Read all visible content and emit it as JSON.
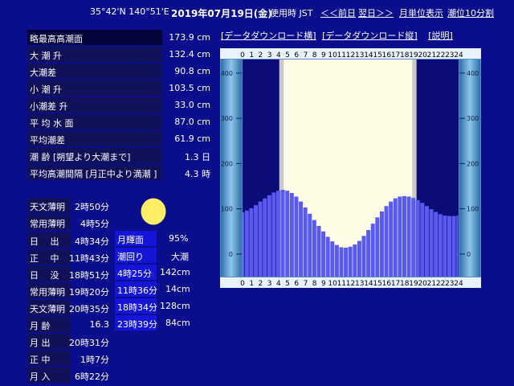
{
  "header": {
    "coords": "35°42'N 140°51'E",
    "date": "2019年07月19日(金)",
    "timezone": "使用時 JST",
    "prev_day": "＜＜前日",
    "next_day": "翌日＞＞",
    "monthly": "月単位表示",
    "interval": "潮位10分割"
  },
  "info": [
    {
      "label": "略最高高潮面",
      "value": "173.9 cm"
    },
    {
      "label": "大 潮 升",
      "value": "132.4 cm"
    },
    {
      "label": "大潮差",
      "value": "90.8 cm"
    },
    {
      "label": "小 潮 升",
      "value": "103.5 cm"
    },
    {
      "label": "小潮差 升",
      "value": "33.0 cm"
    },
    {
      "label": "平 均 水 面",
      "value": "87.0 cm"
    },
    {
      "label": "平均潮差",
      "value": "61.9 cm"
    },
    {
      "label": "潮 齢 [朔望より大潮まで]",
      "value": "1.3 日"
    },
    {
      "label": "平均高潮間隔 [月正中より満潮 ]",
      "value": "4.3 時"
    }
  ],
  "sun_table": [
    {
      "label": "天文薄明",
      "value": "2時50分"
    },
    {
      "label": "常用薄明",
      "value": "4時5分"
    },
    {
      "label": "日　 出",
      "value": "4時34分"
    },
    {
      "label": "正　 中",
      "value": "11時43分"
    },
    {
      "label": "日　 没",
      "value": "18時51分"
    },
    {
      "label": "常用薄明",
      "value": "19時20分"
    },
    {
      "label": "天文薄明",
      "value": "20時35分"
    },
    {
      "label": "月 齢",
      "value": "16.3"
    },
    {
      "label": "月 出",
      "value": "20時31分"
    },
    {
      "label": "正 中",
      "value": "1時7分"
    },
    {
      "label": "月 入",
      "value": "6時22分"
    }
  ],
  "moon": {
    "illum_label": "月輝面",
    "illum_value": "95%",
    "tide_label": "潮回り",
    "tide_value": "大潮"
  },
  "tides": [
    {
      "time": "4時25分",
      "level": "142cm"
    },
    {
      "time": "11時36分",
      "level": "14cm"
    },
    {
      "time": "18時34分",
      "level": "128cm"
    },
    {
      "time": "23時39分",
      "level": "84cm"
    }
  ],
  "chart_links": [
    "[データダウンロード横]",
    "[データダウンロード縦]",
    "[説明]"
  ],
  "chart_data": {
    "type": "bar",
    "xlabel": "",
    "ylabel": "",
    "hours": [
      "0",
      "1",
      "2",
      "3",
      "4",
      "5",
      "6",
      "7",
      "8",
      "9",
      "10",
      "11",
      "12",
      "13",
      "14",
      "15",
      "16",
      "17",
      "18",
      "19",
      "20",
      "21",
      "22",
      "23",
      "24"
    ],
    "y_ticks": [
      "400",
      "300",
      "200",
      "100",
      "0"
    ],
    "ylim": [
      -50,
      430
    ],
    "daylight_hours": [
      4.57,
      18.85
    ],
    "twilight_hours": [
      4.08,
      19.33
    ],
    "x": [
      0,
      0.5,
      1,
      1.5,
      2,
      2.5,
      3,
      3.5,
      4,
      4.5,
      5,
      5.5,
      6,
      6.5,
      7,
      7.5,
      8,
      8.5,
      9,
      9.5,
      10,
      10.5,
      11,
      11.5,
      12,
      12.5,
      13,
      13.5,
      14,
      14.5,
      15,
      15.5,
      16,
      16.5,
      17,
      17.5,
      18,
      18.5,
      19,
      19.5,
      20,
      20.5,
      21,
      21.5,
      22,
      22.5,
      23,
      23.5,
      24
    ],
    "values": [
      92,
      96,
      101,
      108,
      116,
      123,
      130,
      136,
      140,
      142,
      140,
      135,
      127,
      116,
      103,
      89,
      75,
      62,
      50,
      38,
      28,
      20,
      15,
      14,
      16,
      21,
      29,
      40,
      53,
      67,
      81,
      94,
      106,
      116,
      123,
      127,
      128,
      127,
      124,
      119,
      113,
      106,
      99,
      93,
      88,
      85,
      84,
      84,
      85
    ]
  }
}
